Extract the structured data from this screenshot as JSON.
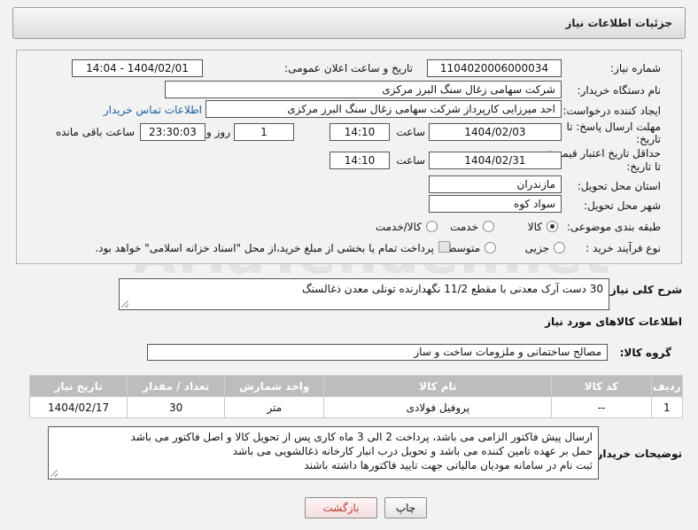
{
  "header": {
    "title": "جزئیات اطلاعات نیاز"
  },
  "fields": {
    "need_number_label": "شماره نیاز:",
    "need_number": "1104020006000034",
    "announce_label": "تاریخ و ساعت اعلان عمومی:",
    "announce_value": "1404/02/01 - 14:04",
    "buyer_org_label": "نام دستگاه خریدار:",
    "buyer_org": "شرکت سهامی زغال سنگ البرز مرکزی",
    "requester_label": "ایجاد کننده درخواست:",
    "requester": "احد میرزایی کارپرداز شرکت سهامی زغال سنگ البرز مرکزی",
    "contact_link": "اطلاعات تماس خریدار",
    "deadline_label_1": "مهلت ارسال پاسخ: تا",
    "deadline_label_2": "تاریخ:",
    "deadline_date": "1404/02/03",
    "time_label": "ساعت",
    "deadline_time": "14:10",
    "days_value": "1",
    "days_label": "روز و",
    "remaining_time": "23:30:03",
    "remaining_label": "ساعت باقی مانده",
    "validity_label_1": "حداقل تاریخ اعتبار قیمت:",
    "validity_label_2": "تا تاریخ:",
    "validity_date": "1404/02/31",
    "validity_time": "14:10",
    "province_label": "استان محل تحویل:",
    "province": "مازندران",
    "city_label": "شهر محل تحویل:",
    "city": "سواد کوه",
    "category_label": "طبقه بندی موضوعی:",
    "category_options": [
      "کالا",
      "خدمت",
      "کالا/خدمت"
    ],
    "process_label": "نوع فرآیند خرید :",
    "process_options": [
      "جزیی",
      "متوسط"
    ],
    "payment_note": "پرداخت تمام یا بخشی از مبلغ خرید،از محل \"اسناد خزانه اسلامی\" خواهد بود."
  },
  "description": {
    "label": "شرح کلی نیاز:",
    "value": "30 دست آرک معدنی با مقطع 11/2 نگهدارنده تونلی معدن ذغالسنگ"
  },
  "goods_section": {
    "title": "اطلاعات کالاهای مورد نیاز",
    "group_label": "گروه کالا:",
    "group_value": "مصالح ساختمانی و ملزومات ساخت و ساز"
  },
  "table": {
    "headers": [
      "ردیف",
      "کد کالا",
      "نام کالا",
      "واحد شمارش",
      "تعداد / مقدار",
      "تاریخ نیاز"
    ],
    "rows": [
      {
        "row": "1",
        "code": "--",
        "name": "پروفیل فولادی",
        "unit": "متر",
        "qty": "30",
        "date": "1404/02/17"
      }
    ]
  },
  "buyer_notes": {
    "label": "توضیحات خریدار:",
    "lines": [
      "ارسال پیش فاکتور الزامی می باشد، پرداخت 2 الی 3 ماه کاری پس از تحویل کالا و اصل فاکتور می باشد",
      "حمل بر عهده تامین کننده می باشد و تحویل درب انبار کارخانه ذغالشویی می باشد",
      "ثبت نام در سامانه مودیان مالیاتی جهت تایید فاکتورها داشته باشند"
    ]
  },
  "buttons": {
    "print": "چاپ",
    "back": "بازگشت"
  },
  "watermark": "AriaTender.net"
}
